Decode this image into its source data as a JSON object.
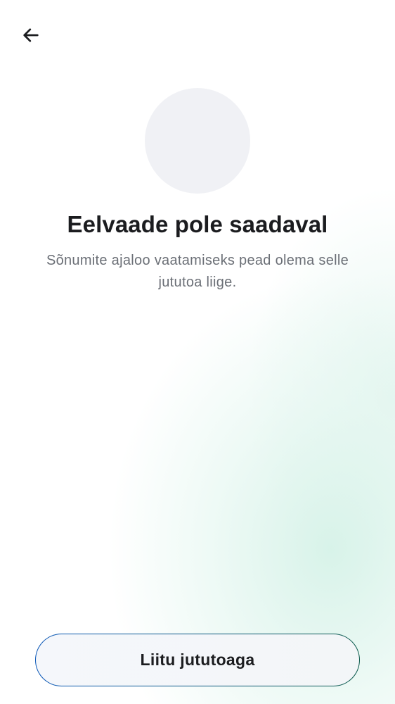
{
  "header": {
    "back_icon": "arrow-left-icon"
  },
  "preview": {
    "title": "Eelvaade pole saadaval",
    "message": "Sõnumite ajaloo vaatamiseks pead olema selle jututoa liige."
  },
  "actions": {
    "join_label": "Liitu jututoaga"
  },
  "colors": {
    "title": "#1b1c1f",
    "subtitle": "#6b6f76",
    "avatar_bg": "#f0f1f5",
    "button_border_start": "#0a57b8",
    "button_border_end": "#0c5a4c",
    "background_tint": "#dff3ec"
  }
}
